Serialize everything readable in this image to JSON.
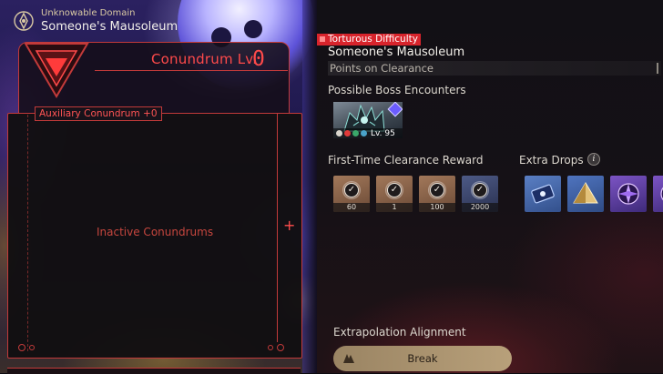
{
  "domain": {
    "label": "Unknowable Domain",
    "title": "Someone's Mausoleum"
  },
  "conundrum": {
    "level_label": "Conundrum Lv.",
    "level_value": "0",
    "auxiliary_label": "Auxiliary Conundrum +0",
    "inactive_label": "Inactive Conundrums",
    "add_symbol": "+"
  },
  "stage": {
    "difficulty": "Torturous Difficulty",
    "title": "Someone's Mausoleum",
    "points_label": "Points on Clearance"
  },
  "boss": {
    "heading": "Possible Boss Encounters",
    "level": "Lv. 95"
  },
  "rewards": {
    "heading": "First-Time Clearance Reward",
    "items": [
      {
        "qty": "60",
        "rarity": "gold"
      },
      {
        "qty": "1",
        "rarity": "gold"
      },
      {
        "qty": "100",
        "rarity": "gold"
      },
      {
        "qty": "2000",
        "rarity": "blue"
      }
    ]
  },
  "extra_drops": {
    "heading": "Extra Drops",
    "info_symbol": "i",
    "items": [
      "blue-ticket-item",
      "golden-pyramid-item",
      "purple-crystal-item",
      "purple-crystal-item-2"
    ]
  },
  "alignment": {
    "heading": "Extrapolation Alignment",
    "button_label": "Break"
  },
  "colors": {
    "accent_red": "#d8242c",
    "conundrum_red": "#ff4a4a",
    "button_gold": "#b8a07a"
  }
}
